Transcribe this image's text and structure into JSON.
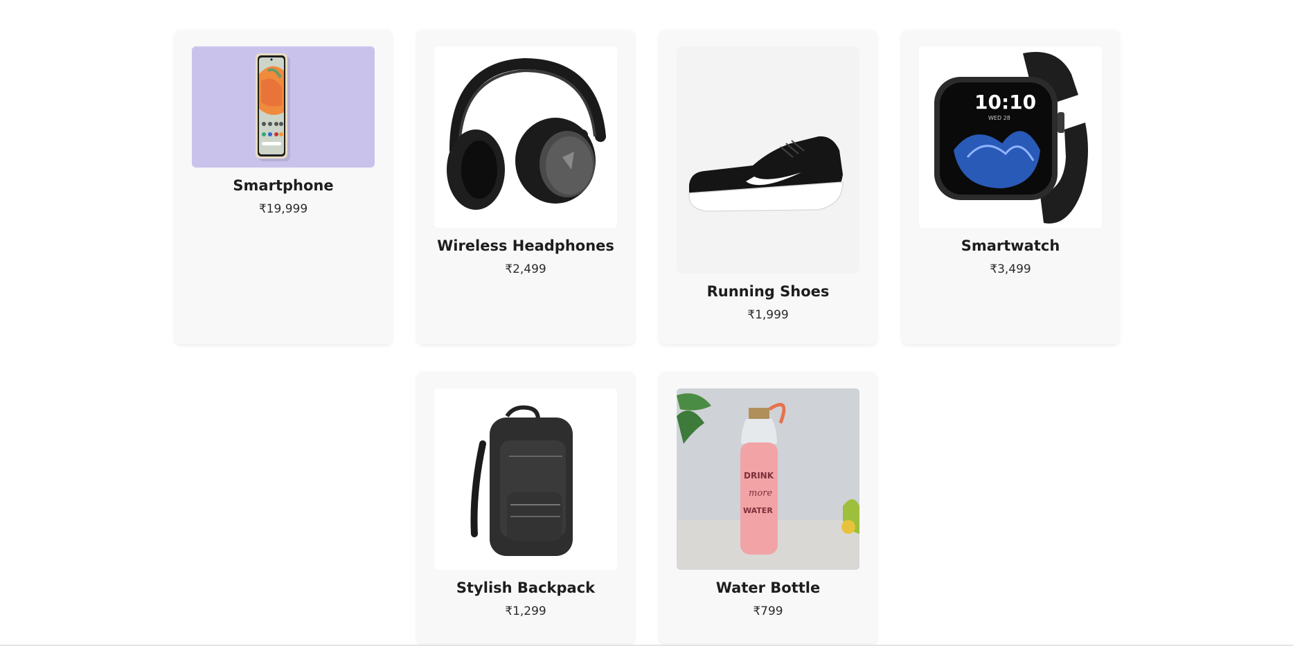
{
  "products": [
    {
      "name": "Smartphone",
      "price": "₹19,999",
      "image_icon": "smartphone-photo"
    },
    {
      "name": "Wireless Headphones",
      "price": "₹2,499",
      "image_icon": "headphones-photo"
    },
    {
      "name": "Running Shoes",
      "price": "₹1,999",
      "image_icon": "shoe-photo"
    },
    {
      "name": "Smartwatch",
      "price": "₹3,499",
      "image_icon": "smartwatch-photo"
    },
    {
      "name": "Stylish Backpack",
      "price": "₹1,299",
      "image_icon": "backpack-photo"
    },
    {
      "name": "Water Bottle",
      "price": "₹799",
      "image_icon": "water-bottle-photo"
    }
  ],
  "images": {
    "watch_time": "10:10",
    "watch_date": "WED 28",
    "bottle_text_1": "DRINK",
    "bottle_text_2": "more",
    "bottle_text_3": "WATER"
  },
  "colors": {
    "card_bg": "#f8f8f8",
    "phone_bg": "#c9c3ec",
    "text": "#1d1d1d"
  }
}
